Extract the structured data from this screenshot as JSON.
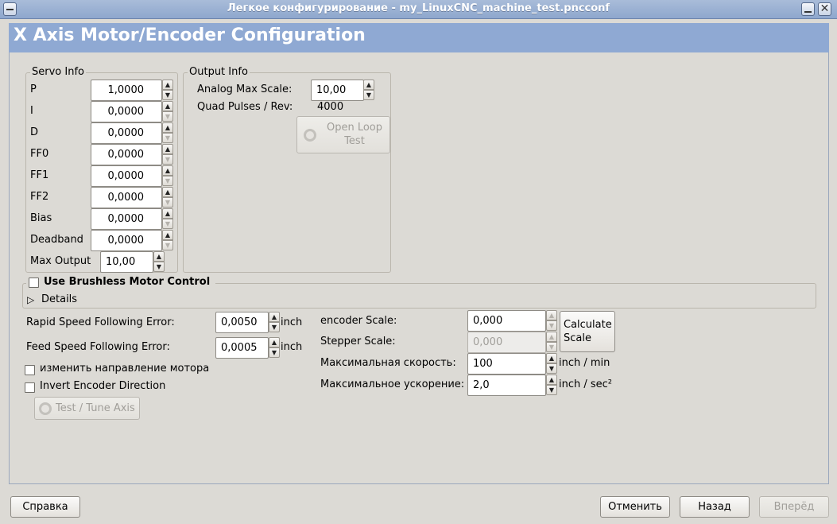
{
  "window": {
    "title": "Легкое конфигурирование - my_LinuxCNC_machine_test.pncconf",
    "close_glyph": "✕"
  },
  "page": {
    "title": "X Axis Motor/Encoder Configuration"
  },
  "servo_info": {
    "label": "Servo Info",
    "rows": [
      {
        "label": "P",
        "value": "1,0000"
      },
      {
        "label": "I",
        "value": "0,0000"
      },
      {
        "label": "D",
        "value": "0,0000"
      },
      {
        "label": "FF0",
        "value": "0,0000"
      },
      {
        "label": "FF1",
        "value": "0,0000"
      },
      {
        "label": "FF2",
        "value": "0,0000"
      },
      {
        "label": "Bias",
        "value": "0,0000"
      },
      {
        "label": "Deadband",
        "value": "0,0000"
      }
    ],
    "max_output": {
      "label": "Max Output",
      "value": "10,00"
    }
  },
  "output_info": {
    "label": "Output Info",
    "analog_max_scale": {
      "label": "Analog Max Scale:",
      "value": "10,00"
    },
    "quad_pulses": {
      "label": "Quad Pulses / Rev:",
      "value": "4000"
    },
    "open_loop_button": {
      "line1": "Open Loop",
      "line2": "Test"
    }
  },
  "brushless": {
    "label": "Use Brushless Motor Control",
    "details_label": "Details",
    "expander_glyph": "▷"
  },
  "following": {
    "rapid": {
      "label": "Rapid Speed Following Error:",
      "value": "0,0050",
      "unit": "inch"
    },
    "feed": {
      "label": "Feed Speed Following Error:",
      "value": "0,0005",
      "unit": "inch"
    }
  },
  "checks": {
    "reverse_motor": "изменить направление мотора",
    "invert_encoder": "Invert Encoder Direction"
  },
  "test_tune_button": "Test / Tune Axis",
  "scales": {
    "encoder_scale": {
      "label": "encoder Scale:",
      "value": "0,000"
    },
    "stepper_scale": {
      "label": "Stepper Scale:",
      "value": "0,000"
    },
    "max_velocity": {
      "label": "Максимальная скорость:",
      "value": "100",
      "unit": "inch / min"
    },
    "max_accel": {
      "label": "Максимальное ускорение:",
      "value": "2,0",
      "unit": "inch / sec²"
    },
    "calculate_button": {
      "line1": "Calculate",
      "line2": "Scale"
    }
  },
  "footer": {
    "help": "Справка",
    "cancel": "Отменить",
    "back": "Назад",
    "forward": "Вперёд"
  },
  "arrows": {
    "up": "▲",
    "down": "▼"
  }
}
